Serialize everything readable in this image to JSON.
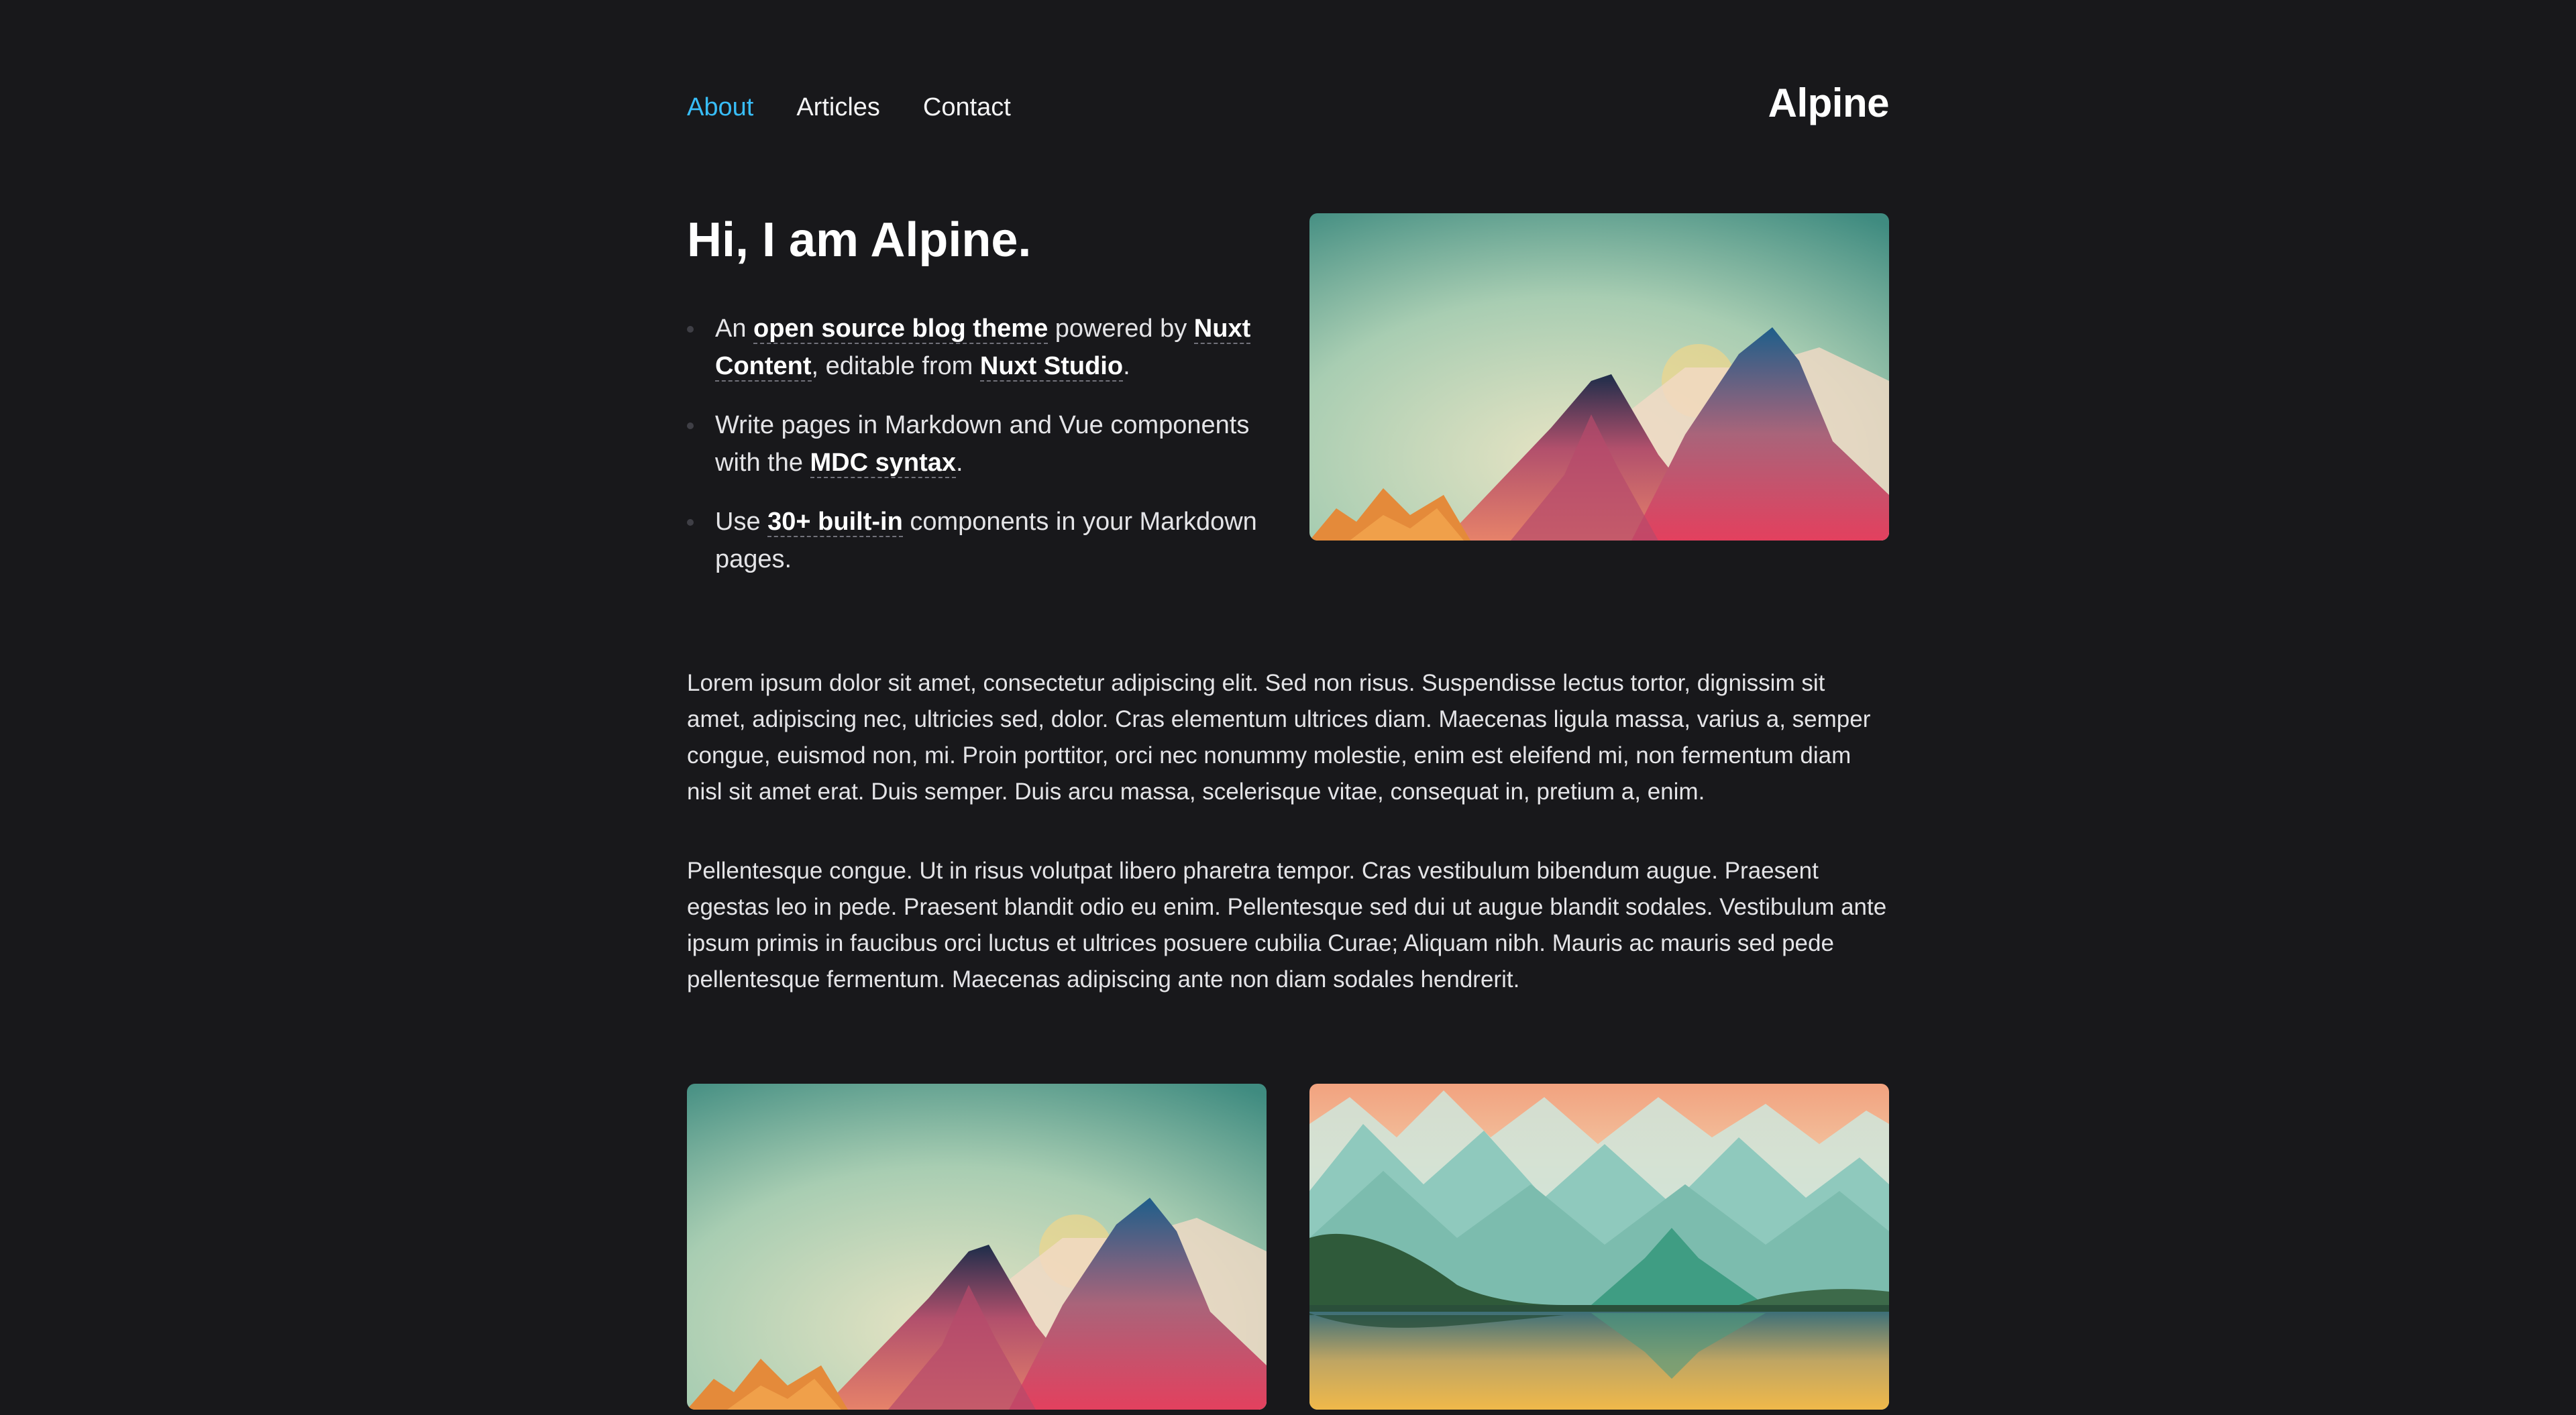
{
  "nav": {
    "items": [
      {
        "label": "About",
        "active": true
      },
      {
        "label": "Articles",
        "active": false
      },
      {
        "label": "Contact",
        "active": false
      }
    ]
  },
  "brand": {
    "name": "Alpine"
  },
  "hero": {
    "title": "Hi, I am Alpine.",
    "items": [
      {
        "parts": [
          "An ",
          "open source blog theme",
          " powered by ",
          "Nuxt Content",
          ", editable from ",
          "Nuxt Studio",
          "."
        ]
      },
      {
        "parts": [
          "Write pages in Markdown and Vue components with the ",
          "MDC syntax",
          "."
        ]
      },
      {
        "parts": [
          "Use ",
          "30+ built-in",
          " components in your Markdown pages."
        ]
      }
    ]
  },
  "content": {
    "paragraph_1": "Lorem ipsum dolor sit amet, consectetur adipiscing elit. Sed non risus. Suspendisse lectus tortor, dignissim sit amet, adipiscing nec, ultricies sed, dolor. Cras elementum ultrices diam. Maecenas ligula massa, varius a, semper congue, euismod non, mi. Proin porttitor, orci nec nonummy molestie, enim est eleifend mi, non fermentum diam nisl sit amet erat. Duis semper. Duis arcu massa, scelerisque vitae, consequat in, pretium a, enim.",
    "paragraph_2": "Pellentesque congue. Ut in risus volutpat libero pharetra tempor. Cras vestibulum bibendum augue. Praesent egestas leo in pede. Praesent blandit odio eu enim. Pellentesque sed dui ut augue blandit sodales. Vestibulum ante ipsum primis in faucibus orci luctus et ultrices posuere cubilia Curae; Aliquam nibh. Mauris ac mauris sed pede pellentesque fermentum. Maecenas adipiscing ante non diam sodales hendrerit."
  },
  "colors": {
    "background": "#18181b",
    "text": "#e4e4e7",
    "accent": "#38bdf8",
    "link_underline": "#71717a"
  }
}
